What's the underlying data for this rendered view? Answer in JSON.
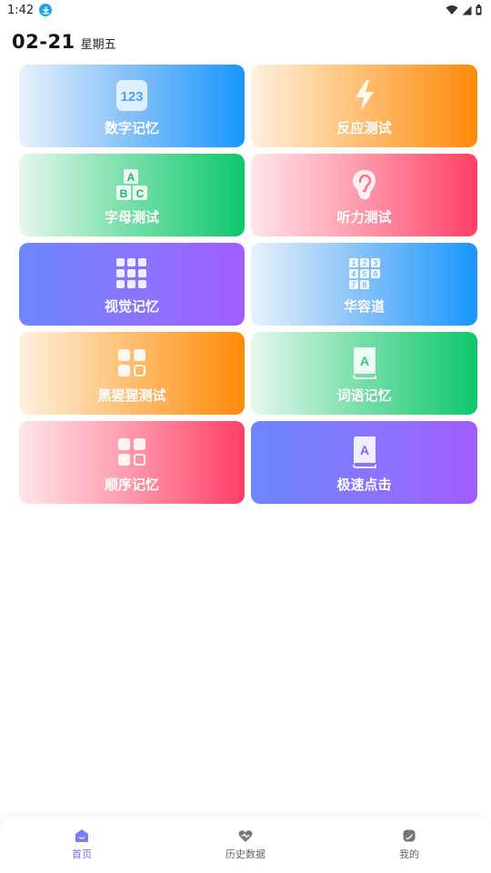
{
  "status_bar": {
    "time": "1:42",
    "download_icon": "download-icon",
    "wifi_icon": "wifi-icon",
    "signal_icon": "signal-icon",
    "battery_icon": "battery-icon"
  },
  "header": {
    "date": "02-21",
    "weekday": "星期五"
  },
  "cards": [
    {
      "label": "数字记忆",
      "icon": "number-123-icon",
      "gradient": "blue"
    },
    {
      "label": "反应测试",
      "icon": "lightning-icon",
      "gradient": "orange"
    },
    {
      "label": "字母测试",
      "icon": "abc-blocks-icon",
      "gradient": "green"
    },
    {
      "label": "听力测试",
      "icon": "ear-icon",
      "gradient": "pink"
    },
    {
      "label": "视觉记忆",
      "icon": "dot-grid-icon",
      "gradient": "purple"
    },
    {
      "label": "华容道",
      "icon": "number-puzzle-icon",
      "gradient": "blue"
    },
    {
      "label": "黑猩猩测试",
      "icon": "squares-icon",
      "gradient": "orange"
    },
    {
      "label": "词语记忆",
      "icon": "letter-book-icon",
      "gradient": "green"
    },
    {
      "label": "顺序记忆",
      "icon": "squares-icon",
      "gradient": "pink"
    },
    {
      "label": "极速点击",
      "icon": "letter-book-icon",
      "gradient": "purple"
    }
  ],
  "bottom_nav": [
    {
      "label": "首页",
      "icon": "home-icon",
      "active": true
    },
    {
      "label": "历史数据",
      "icon": "history-icon",
      "active": false
    },
    {
      "label": "我的",
      "icon": "profile-icon",
      "active": false
    }
  ],
  "colors": {
    "accent": "#6a73e8",
    "blue": "#1a95ff",
    "orange": "#ff8a0a",
    "green": "#0ec76d",
    "pink": "#ff3f66",
    "purple": "#a25cff"
  }
}
